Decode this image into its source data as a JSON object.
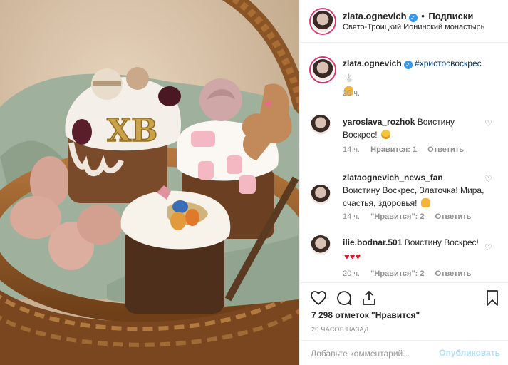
{
  "header": {
    "username": "zlata.ognevich",
    "follow_label": "Подписки",
    "separator": "•",
    "location": "Свято-Троицкий Ионинский монастырь"
  },
  "caption": {
    "username": "zlata.ognevich",
    "hashtag": "#христосвоскрес",
    "time": "20 ч."
  },
  "comments": [
    {
      "username": "yaroslava_rozhok",
      "text": "Воистину Воскрес!",
      "time": "14 ч.",
      "likes": "Нравится: 1",
      "reply": "Ответить"
    },
    {
      "username": "zlataognevich_news_fan",
      "text": "Воистину Воскрес, Златочка! Мира, счастья, здоровья!",
      "time": "14 ч.",
      "likes": "\"Нравится\": 2",
      "reply": "Ответить"
    },
    {
      "username": "ilie.bodnar.501",
      "text": "Воистину Воскрес!",
      "time": "20 ч.",
      "likes": "\"Нравится\": 2",
      "reply": "Ответить"
    }
  ],
  "actions": {
    "likes_text": "7 298 отметок \"Нравится\"",
    "time_ago": "20 ЧАСОВ НАЗАД"
  },
  "add_comment": {
    "placeholder": "Добавьте комментарий...",
    "post_label": "Опубликовать"
  },
  "photo": {
    "cake_text": "ХВ"
  },
  "colors": {
    "link_blue": "#3897f0",
    "hashtag": "#003569",
    "muted": "#8e8e8e",
    "post_disabled": "#b2dffc"
  }
}
